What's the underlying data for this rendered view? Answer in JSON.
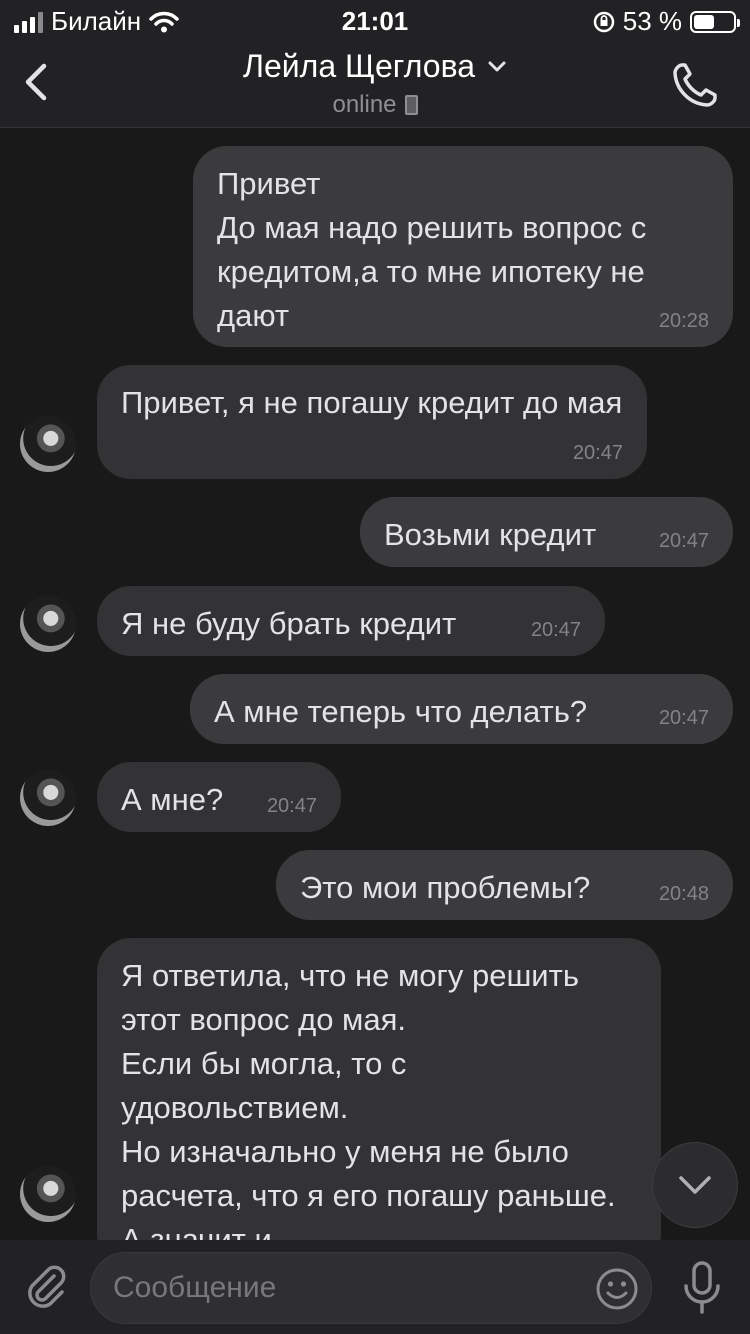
{
  "status_bar": {
    "carrier": "Билайн",
    "time": "21:01",
    "battery": "53 %",
    "battery_level": 0.53
  },
  "header": {
    "contact_name": "Лейла Щеглова",
    "status": "online"
  },
  "messages": [
    {
      "direction": "out",
      "text": "Привет\nДо мая надо решить вопрос с кредитом,а то мне ипотеку не дают",
      "time": "20:28"
    },
    {
      "direction": "in",
      "text": "Привет, я не погашу кредит до мая",
      "time": "20:47"
    },
    {
      "direction": "out",
      "text": "Возьми кредит",
      "time": "20:47"
    },
    {
      "direction": "in",
      "text": "Я не буду брать кредит",
      "time": "20:47"
    },
    {
      "direction": "out",
      "text": "А мне теперь что делать?",
      "time": "20:47"
    },
    {
      "direction": "in",
      "text": "А мне?",
      "time": "20:47"
    },
    {
      "direction": "out",
      "text": "Это мои проблемы?",
      "time": "20:48"
    },
    {
      "direction": "in",
      "text": "Я ответила, что не могу решить этот вопрос до мая.\nЕсли бы могла, то с удовольствием.\nНо изначально у меня не было расчета, что я его погашу раньше. А значит и",
      "time": ""
    }
  ],
  "composer": {
    "placeholder": "Сообщение"
  },
  "icons": {
    "back": "chevron-left-icon",
    "call": "phone-icon",
    "attach": "paperclip-icon",
    "emoji": "smiley-icon",
    "mic": "microphone-icon",
    "scroll": "chevron-down-icon"
  }
}
